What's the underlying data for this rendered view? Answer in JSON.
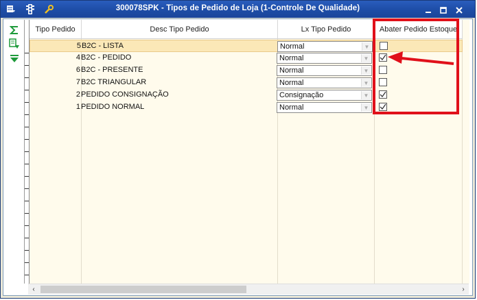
{
  "window": {
    "title": "300078SPK - Tipos de Pedido de Loja (1-Controle De Qualidade)",
    "icons": [
      "grid-menu-icon",
      "traffic-light-icon",
      "wrench-icon"
    ],
    "controls": [
      "minimize-icon",
      "maximize-icon",
      "close-icon"
    ]
  },
  "sidebar": {
    "icons": [
      "sigma-icon",
      "export-icon",
      "filter-down-icon"
    ]
  },
  "grid": {
    "columns": [
      "Tipo Pedido",
      "Desc Tipo Pedido",
      "Lx Tipo Pedido",
      "Abater Pedido Estoque"
    ],
    "rows": [
      {
        "tipo": "5",
        "desc": "B2C - LISTA",
        "lx": "Normal",
        "abater": false,
        "selected": true
      },
      {
        "tipo": "4",
        "desc": "B2C - PEDIDO",
        "lx": "Normal",
        "abater": true,
        "selected": false
      },
      {
        "tipo": "6",
        "desc": "B2C - PRESENTE",
        "lx": "Normal",
        "abater": false,
        "selected": false
      },
      {
        "tipo": "7",
        "desc": "B2C TRIANGULAR",
        "lx": "Normal",
        "abater": false,
        "selected": false
      },
      {
        "tipo": "2",
        "desc": "PEDIDO CONSIGNAÇÃO",
        "lx": "Consignação",
        "abater": true,
        "selected": false
      },
      {
        "tipo": "1",
        "desc": "PEDIDO NORMAL",
        "lx": "Normal",
        "abater": true,
        "selected": false
      }
    ]
  },
  "annotation": {
    "color": "#e0101a"
  }
}
